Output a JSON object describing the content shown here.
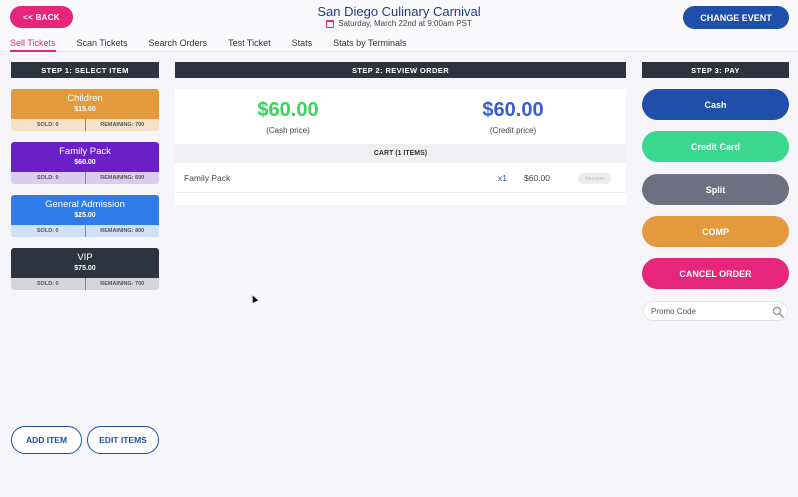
{
  "header": {
    "back_label": "<< BACK",
    "event_title": "San Diego Culinary Carnival",
    "event_date": "Saturday, March 22nd at 9:00am PST",
    "change_event_label": "CHANGE EVENT"
  },
  "nav": {
    "tabs": [
      {
        "label": "Sell Tickets",
        "active": true
      },
      {
        "label": "Scan Tickets"
      },
      {
        "label": "Search Orders"
      },
      {
        "label": "Test Ticket"
      },
      {
        "label": "Stats"
      },
      {
        "label": "Stats by Terminals"
      }
    ]
  },
  "steps": {
    "step1": "STEP 1: SELECT ITEM",
    "step2": "STEP 2: REVIEW ORDER",
    "step3": "STEP 3: PAY"
  },
  "items": [
    {
      "name": "Children",
      "price": "$15.00",
      "sold": "SOLD: 0",
      "remaining": "REMAINING: 700",
      "color": "#e39a3c",
      "footer_color": "#f6e2c9"
    },
    {
      "name": "Family Pack",
      "price": "$60.00",
      "sold": "SOLD: 0",
      "remaining": "REMAINING: 600",
      "color": "#6b1fc7",
      "footer_color": "#dccdf0"
    },
    {
      "name": "General Admission",
      "price": "$25.00",
      "sold": "SOLD: 0",
      "remaining": "REMAINING: 800",
      "color": "#2f7ce8",
      "footer_color": "#cfe0f7"
    },
    {
      "name": "VIP",
      "price": "$75.00",
      "sold": "SOLD: 0",
      "remaining": "REMAINING: 700",
      "color": "#2d3340",
      "footer_color": "#d5d6d9"
    }
  ],
  "item_actions": {
    "add_label": "ADD ITEM",
    "edit_label": "EDIT ITEMS"
  },
  "review": {
    "cash_total": "$60.00",
    "cash_label": "(Cash price)",
    "credit_total": "$60.00",
    "credit_label": "(Credit price)",
    "cart_header": "CART (1 ITEMS)",
    "cart_items": [
      {
        "name": "Family Pack",
        "qty": "x1",
        "amount": "$60.00",
        "remove_label": "Remove"
      }
    ]
  },
  "pay": {
    "buttons": [
      {
        "label": "Cash",
        "color": "#1f4fa8"
      },
      {
        "label": "Credit Card",
        "color": "#3ad88e"
      },
      {
        "label": "Split",
        "color": "#6e7081"
      },
      {
        "label": "COMP",
        "color": "#e39a3c"
      },
      {
        "label": "CANCEL ORDER",
        "color": "#e6267a"
      }
    ],
    "promo_placeholder": "Promo Code"
  },
  "colors": {
    "accent": "#e6267a",
    "primary": "#1f4fa8",
    "cash_green": "#3ad35c",
    "credit_blue": "#3b5bd6"
  }
}
